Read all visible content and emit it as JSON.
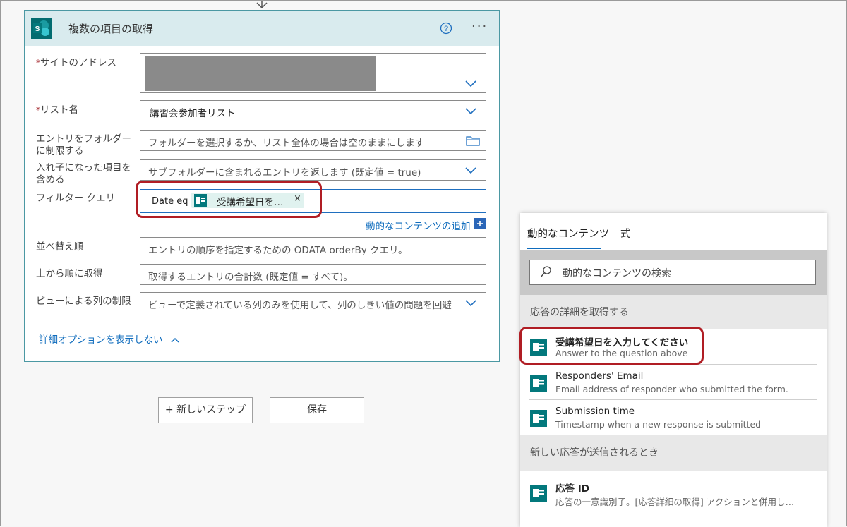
{
  "card": {
    "title": "複数の項目の取得",
    "fields": {
      "site": {
        "label": "サイトのアドレス",
        "required": true
      },
      "list": {
        "label": "リスト名",
        "required": true,
        "value": "講習会参加者リスト"
      },
      "folder": {
        "label_line1": "エントリをフォルダー",
        "label_line2": "に制限する",
        "placeholder": "フォルダーを選択するか、リスト全体の場合は空のままにします"
      },
      "nested": {
        "label_line1": "入れ子になった項目を",
        "label_line2": "含める",
        "placeholder": "サブフォルダーに含まれるエントリを返します (既定値 = true)"
      },
      "filter": {
        "label": "フィルター クエリ",
        "prefix": "Date eq '",
        "token": "受講希望日を…",
        "token_close": "×"
      },
      "order": {
        "label": "並べ替え順",
        "placeholder": "エントリの順序を指定するための ODATA orderBy クエリ。"
      },
      "top": {
        "label": "上から順に取得",
        "placeholder": "取得するエントリの合計数 (既定値 = すべて)。"
      },
      "view": {
        "label": "ビューによる列の制限",
        "placeholder": "ビューで定義されている列のみを使用して、列のしきい値の問題を回避"
      }
    },
    "add_dynamic": "動的なコンテンツの追加",
    "hide_advanced": "詳細オプションを表示しない"
  },
  "buttons": {
    "new_step": "+ 新しいステップ",
    "save": "保存"
  },
  "panel": {
    "tabs": [
      "動的なコンテンツ",
      "式"
    ],
    "search_placeholder": "動的なコンテンツの検索",
    "sections": [
      {
        "title": "応答の詳細を取得する",
        "items": [
          {
            "title": "受講希望日を入力してください",
            "desc": "Answer to the question above"
          },
          {
            "title": "Responders' Email",
            "desc": "Email address of responder who submitted the form."
          },
          {
            "title": "Submission time",
            "desc": "Timestamp when a new response is submitted"
          }
        ]
      },
      {
        "title": "新しい応答が送信されるとき",
        "items": [
          {
            "title": "応答 ID",
            "desc": "応答の一意識別子。[応答詳細の取得] アクションと併用し…"
          }
        ]
      }
    ]
  },
  "colors": {
    "accent": "#0f6cbd",
    "header": "#d9ebee",
    "highlight": "#b01d24",
    "forms_green": "#03787c"
  },
  "icons": {
    "card": "sharepoint-icon",
    "help": "help-circle-icon",
    "more": "more-options-icon",
    "chevron": "chevron-down-icon",
    "folder": "folder-icon",
    "search": "search-icon",
    "form": "forms-icon"
  }
}
